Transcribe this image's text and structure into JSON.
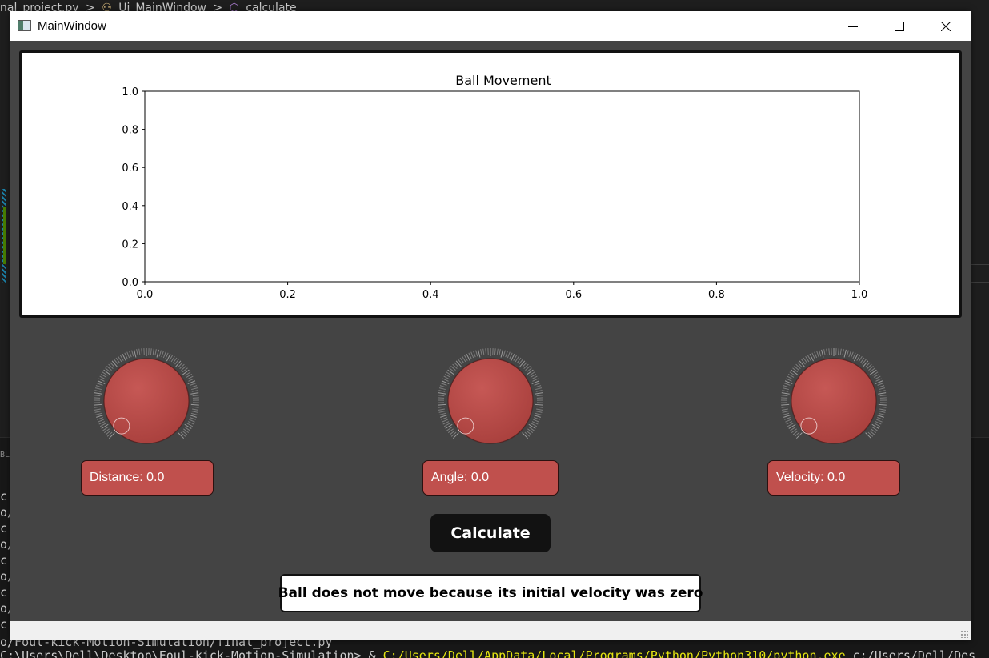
{
  "background": {
    "breadcrumb": [
      "nal_project.py",
      ">",
      "Ui_MainWindow",
      ">",
      "calculate"
    ],
    "terminal_tab": "BLE",
    "terminal_left": [
      "c:",
      "o/",
      "c:",
      "o/",
      "c:",
      "o/",
      "c:",
      "o/",
      "c:"
    ],
    "terminal_line1": "o/Foul-kick-Motion-Simulation/final_project.py",
    "terminal_line2_prefix": "C:\\Users\\Dell\\Desktop\\Foul-kick-Motion-Simulation> & ",
    "terminal_line2_path": "C:/Users/Dell/AppData/Local/Programs/Python/Python310/python.exe",
    "terminal_line2_suffix": " c:/Users/Dell/Des"
  },
  "window": {
    "title": "MainWindow",
    "icons": {
      "app": "app-icon",
      "minimize": "minimize-icon",
      "maximize": "maximize-icon",
      "close": "close-icon"
    }
  },
  "plot": {
    "chart_data": {
      "type": "line",
      "title": "Ball Movement",
      "xlabel": "",
      "ylabel": "",
      "xlim": [
        0.0,
        1.0
      ],
      "ylim": [
        0.0,
        1.0
      ],
      "xticks": [
        "0.0",
        "0.2",
        "0.4",
        "0.6",
        "0.8",
        "1.0"
      ],
      "yticks": [
        "0.0",
        "0.2",
        "0.4",
        "0.6",
        "0.8",
        "1.0"
      ],
      "series": [],
      "grid": false
    }
  },
  "controls": {
    "distance": {
      "label": "Distance: 0.0",
      "value": 0.0
    },
    "angle": {
      "label": "Angle: 0.0",
      "value": 0.0
    },
    "velocity": {
      "label": "Velocity: 0.0",
      "value": 0.0
    },
    "dial_color": "#c0504d"
  },
  "calculate_label": "Calculate",
  "result_message": "Ball does not move because its initial velocity was zero"
}
